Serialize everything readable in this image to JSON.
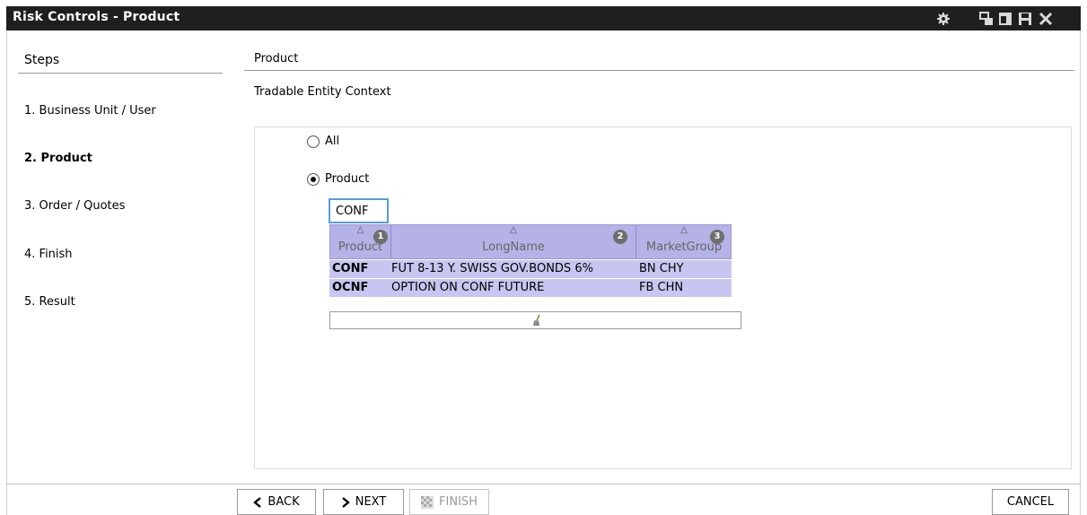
{
  "window": {
    "title": "Risk Controls - Product",
    "controls": [
      "gear-icon",
      "restore-icon",
      "maximize-icon",
      "save-icon",
      "close-icon"
    ]
  },
  "steps": {
    "title": "Steps",
    "items": [
      {
        "label": "1. Business Unit / User",
        "active": false
      },
      {
        "label": "2. Product",
        "active": true
      },
      {
        "label": "3. Order / Quotes",
        "active": false
      },
      {
        "label": "4. Finish",
        "active": false
      },
      {
        "label": "5. Result",
        "active": false
      }
    ]
  },
  "main": {
    "section_title": "Product",
    "context_label": "Tradable Entity Context",
    "radio_all": "All",
    "radio_product": "Product",
    "selected_radio": "Product",
    "filter_value": "CONF"
  },
  "grid": {
    "columns": [
      {
        "label": "Product",
        "sort_order": "1"
      },
      {
        "label": "LongName",
        "sort_order": "2"
      },
      {
        "label": "MarketGroup",
        "sort_order": "3"
      }
    ],
    "rows": [
      [
        "CONF",
        "FUT 8-13 Y. SWISS GOV.BONDS 6%",
        "BN CHY"
      ],
      [
        "OCNF",
        "OPTION ON CONF FUTURE",
        "FB CHN"
      ]
    ],
    "footer_icon": "broom-icon"
  },
  "buttons": {
    "back": "BACK",
    "next": "NEXT",
    "finish": "FINISH",
    "cancel": "CANCEL"
  },
  "colors": {
    "titlebar": "#1f1f1f",
    "grid_header": "#b4b2e6",
    "grid_row": "#c7c6f0",
    "input_focus": "#5b9bd5"
  }
}
